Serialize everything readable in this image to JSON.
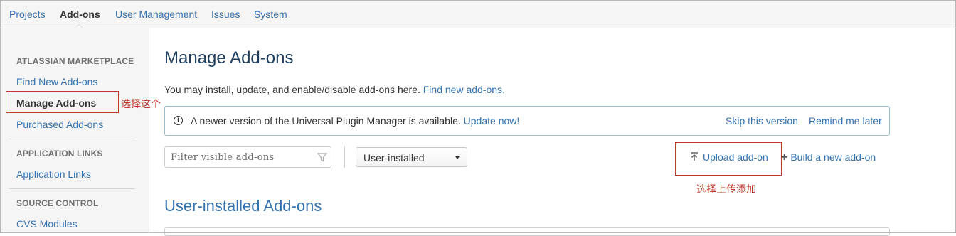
{
  "topnav": {
    "items": [
      {
        "label": "Projects"
      },
      {
        "label": "Add-ons"
      },
      {
        "label": "User Management"
      },
      {
        "label": "Issues"
      },
      {
        "label": "System"
      }
    ]
  },
  "sidebar": {
    "sections": [
      {
        "heading": "ATLASSIAN MARKETPLACE",
        "items": [
          "Find New Add-ons",
          "Manage Add-ons",
          "Purchased Add-ons"
        ]
      },
      {
        "heading": "APPLICATION LINKS",
        "items": [
          "Application Links"
        ]
      },
      {
        "heading": "SOURCE CONTROL",
        "items": [
          "CVS Modules"
        ]
      }
    ],
    "selected": "Manage Add-ons"
  },
  "annotations": {
    "sidebar_note": "选择这个",
    "upload_note": "选择上传添加",
    "color": "#c0392b"
  },
  "main": {
    "title": "Manage Add-ons",
    "intro_text": "You may install, update, and enable/disable add-ons here.",
    "intro_link": "Find new add-ons.",
    "notice": {
      "icon": "info-icon",
      "text": "A newer version of the Universal Plugin Manager is available.",
      "link": "Update now!",
      "skip": "Skip this version",
      "remind": "Remind me later"
    },
    "filter_placeholder": "Filter visible add-ons",
    "select_value": "User-installed",
    "upload_label": "Upload add-on",
    "build_label": "Build a new add-on",
    "section_title": "User-installed Add-ons"
  },
  "colors": {
    "link": "#3572b0",
    "title": "#1f3d5c",
    "sidebar_bg": "#f5f5f5"
  }
}
